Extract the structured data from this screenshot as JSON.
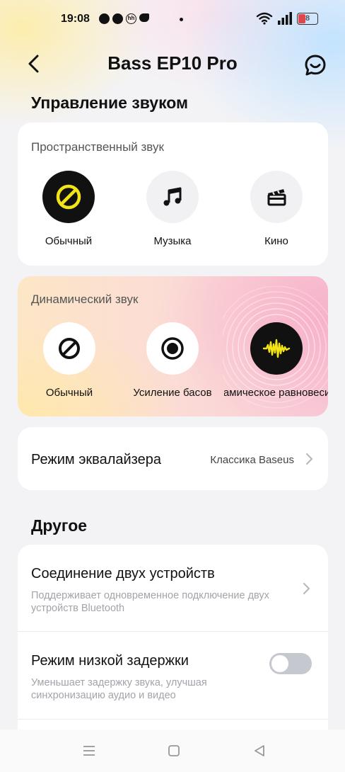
{
  "status_bar": {
    "time": "19:08",
    "battery": "8",
    "accent_battery": "#e0474c"
  },
  "header": {
    "title": "Bass EP10 Pro",
    "back_icon": "chevron-left-icon",
    "support_icon": "chat-bubble-icon"
  },
  "sound_control": {
    "section_title": "Управление звуком",
    "spatial": {
      "label": "Пространственный звук",
      "options": [
        {
          "label": "Обычный",
          "icon": "off-icon",
          "active": true
        },
        {
          "label": "Музыка",
          "icon": "music-note-icon",
          "active": false
        },
        {
          "label": "Кино",
          "icon": "clapperboard-icon",
          "active": false
        }
      ]
    },
    "dynamic": {
      "label": "Динамический звук",
      "options": [
        {
          "label": "Обычный",
          "icon": "off-icon",
          "active": false
        },
        {
          "label": "Усиление басов",
          "icon": "bass-icon",
          "active": false
        },
        {
          "label": "Динамическое равновесие",
          "icon": "waveform-icon",
          "active": true
        }
      ]
    },
    "equalizer": {
      "label": "Режим эквалайзера",
      "value": "Классика Baseus"
    }
  },
  "other": {
    "section_title": "Другое",
    "dual_connection": {
      "title": "Соединение двух устройств",
      "subtitle": "Поддерживает одновременное подключение двух устройств Bluetooth"
    },
    "low_latency": {
      "title": "Режим низкой задержки",
      "subtitle": "Уменьшает задержку звука, улучшая синхронизацию аудио и видео",
      "enabled": false
    }
  },
  "colors": {
    "accent_yellow": "#f2e415",
    "active_bg": "#111111"
  }
}
